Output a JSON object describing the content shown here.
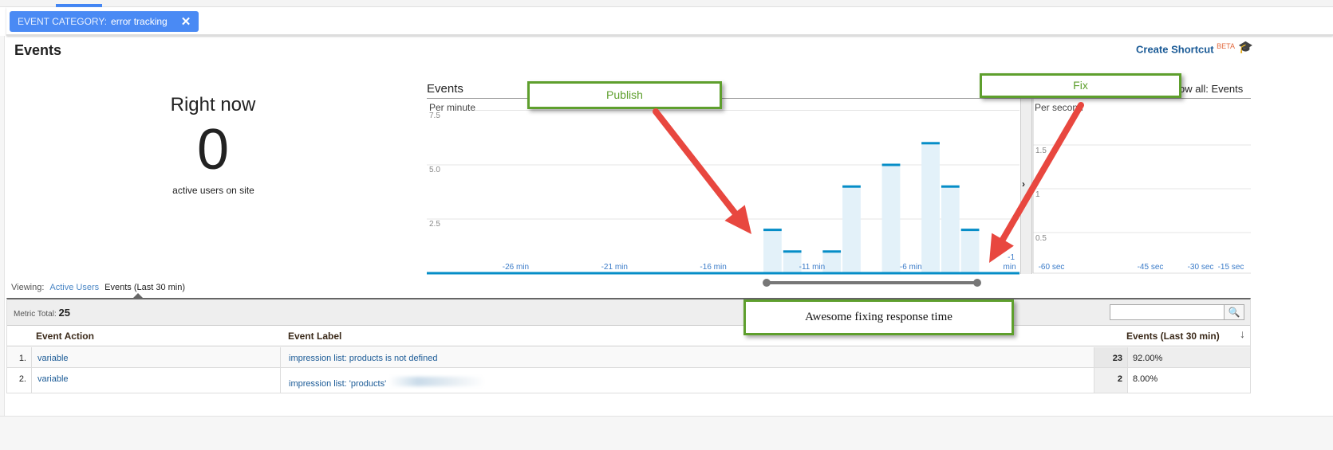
{
  "filter": {
    "key": "EVENT CATEGORY:",
    "value": "error tracking",
    "close_icon": "close-icon"
  },
  "header": {
    "title": "Events",
    "shortcut": "Create Shortcut",
    "beta": "BETA",
    "cap_icon": "graduation-cap-icon"
  },
  "right_now": {
    "title": "Right now",
    "count": "0",
    "subtitle": "active users on site"
  },
  "chart_title": "Events",
  "show_all": "ow all: Events",
  "chart_data": [
    {
      "type": "bar",
      "subtitle": "Per minute",
      "ylim": [
        0,
        7.5
      ],
      "yticks": [
        "7.5",
        "5.0",
        "2.5"
      ],
      "ytick_values": [
        7.5,
        5.0,
        2.5
      ],
      "xtick_labels": [
        "-26 min",
        "-21 min",
        "-16 min",
        "-11 min",
        "-6 min",
        "-1 min"
      ],
      "x": [
        -30,
        -29,
        -28,
        -27,
        -26,
        -25,
        -24,
        -23,
        -22,
        -21,
        -20,
        -19,
        -18,
        -17,
        -16,
        -15,
        -14,
        -13,
        -12,
        -11,
        -10,
        -9,
        -8,
        -7,
        -6,
        -5,
        -4,
        -3,
        -2,
        -1
      ],
      "values": [
        0,
        0,
        0,
        0,
        0,
        0,
        0,
        0,
        0,
        0,
        0,
        0,
        0,
        0,
        0,
        0,
        0,
        2,
        1,
        0,
        1,
        4,
        0,
        5,
        0,
        6,
        4,
        2,
        0,
        0
      ],
      "colors": {
        "bar_fill": "#e3f1f9",
        "bar_top": "#058dc7"
      }
    },
    {
      "type": "bar",
      "subtitle": "Per second",
      "ylim": [
        0,
        2
      ],
      "yticks": [
        "1.5",
        "1",
        "0.5"
      ],
      "ytick_values": [
        1.5,
        1,
        0.5
      ],
      "xtick_labels": [
        "-60 sec",
        "-45 sec",
        "-30 sec",
        "-15 sec"
      ],
      "values": []
    }
  ],
  "viewing": {
    "label": "Viewing:",
    "active_users": "Active Users",
    "events": "Events (Last 30 min)"
  },
  "table": {
    "metric_label": "Metric Total:",
    "metric_total": "25",
    "search_placeholder": "",
    "headers": [
      "Event Action",
      "Event Label",
      "Events (Last 30 min)"
    ],
    "rows": [
      {
        "n": "1.",
        "action": "variable",
        "label": "impression list: products is not defined",
        "count": "23",
        "pct": "92.00%"
      },
      {
        "n": "2.",
        "action": "variable",
        "label": "impression list: 'products'",
        "count": "2",
        "pct": "8.00%"
      }
    ]
  },
  "annotations": {
    "publish": "Publish",
    "fix": "Fix",
    "response": "Awesome fixing response time",
    "arrow_color": "#e8473f",
    "box_color": "#5e9f2d"
  }
}
